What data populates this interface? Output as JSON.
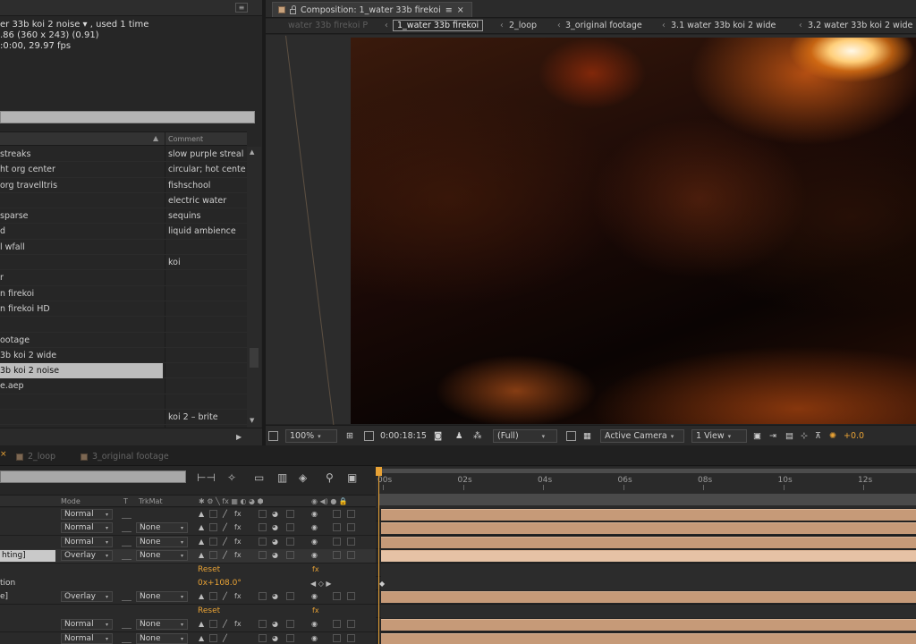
{
  "project": {
    "info_line1": "er 33b koi 2 noise ▾ , used 1 time",
    "info_line2": ".86  (360 x 243) (0.91)",
    "info_line3": ":0:00, 29.97 fps",
    "menu_icon": "hamburger-icon",
    "column_comment": "Comment",
    "sort_indicator": "▲",
    "items": [
      {
        "name": " streaks",
        "comment": "slow purple streal"
      },
      {
        "name": "ht org center",
        "comment": "circular; hot cente"
      },
      {
        "name": "org travelltris",
        "comment": "fishschool"
      },
      {
        "name": "",
        "comment": "electric water"
      },
      {
        "name": " sparse",
        "comment": "sequins"
      },
      {
        "name": "d",
        "comment": "liquid ambience"
      },
      {
        "name": "l wfall",
        "comment": ""
      },
      {
        "name": "",
        "comment": "koi"
      },
      {
        "name": "r",
        "comment": ""
      },
      {
        "name": "n firekoi",
        "comment": ""
      },
      {
        "name": "n firekoi HD",
        "comment": ""
      },
      {
        "name": "",
        "comment": ""
      },
      {
        "name": "ootage",
        "comment": ""
      },
      {
        "name": "3b koi 2 wide",
        "comment": ""
      },
      {
        "name": "3b koi 2 noise",
        "comment": "",
        "selected": true
      },
      {
        "name": "e.aep",
        "comment": ""
      },
      {
        "name": "",
        "comment": ""
      },
      {
        "name": "",
        "comment": "koi 2 – brite"
      }
    ]
  },
  "composition": {
    "tab_label": "Composition: 1_water 33b firekoi",
    "tab_menu": "≡",
    "tab_close": "×",
    "nav": {
      "faded": "water 33b firekoi P",
      "active": "1_water 33b firekoi",
      "items": [
        "2_loop",
        "3_original footage",
        "3.1 water 33b koi 2 wide",
        "3.2 water 33b koi 2 wide"
      ],
      "separator": "‹"
    },
    "viewer": {
      "zoom": "100%",
      "timecode": "0:00:18:15",
      "resolution": "(Full)",
      "camera": "Active Camera",
      "views": "1 View",
      "exposure": "+0.0"
    }
  },
  "timeline": {
    "tabs": [
      "2_loop",
      "3_original footage"
    ],
    "columns": {
      "mode": "Mode",
      "t": "T",
      "trkmat": "TrkMat"
    },
    "ruler": [
      "00s",
      "02s",
      "04s",
      "06s",
      "08s",
      "10s",
      "12s"
    ],
    "layers": [
      {
        "label": "",
        "mode": "Normal",
        "trkmat": "",
        "fx": "fx"
      },
      {
        "label": "",
        "mode": "Normal",
        "trkmat": "None",
        "fx": "fx"
      },
      {
        "label": "",
        "mode": "Normal",
        "trkmat": "None",
        "fx": "fx"
      },
      {
        "label": "hting]",
        "mode": "Overlay",
        "trkmat": "None",
        "fx": "fx",
        "selected": true
      },
      {
        "label": "",
        "reset": "Reset",
        "fx": "fx",
        "type": "effect"
      },
      {
        "label": "tion",
        "value": "0x+108.0°",
        "type": "property"
      },
      {
        "label": "e]",
        "mode": "Overlay",
        "trkmat": "None",
        "fx": "fx"
      },
      {
        "label": "",
        "reset": "Reset",
        "fx": "fx",
        "type": "effect"
      },
      {
        "label": "",
        "mode": "Normal",
        "trkmat": "None",
        "fx": "fx"
      },
      {
        "label": "",
        "mode": "Normal",
        "trkmat": "None",
        "fx": ""
      }
    ]
  },
  "colors": {
    "accent": "#e8a235",
    "layer_bar": "#c69a78",
    "label_swatch": "#c8a27c"
  }
}
